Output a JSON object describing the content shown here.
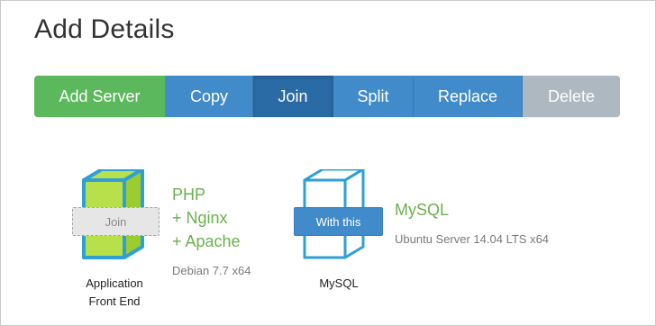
{
  "page": {
    "title": "Add Details"
  },
  "toolbar": {
    "add_server": "Add Server",
    "copy": "Copy",
    "join": "Join",
    "split": "Split",
    "replace": "Replace",
    "delete": "Delete"
  },
  "servers": [
    {
      "chip": "Join",
      "label_line1": "Application",
      "label_line2": "Front End",
      "stack": [
        "PHP",
        "+ Nginx",
        "+ Apache"
      ],
      "os": "Debian 7.7 x64"
    },
    {
      "chip": "With this",
      "label_line1": "MySQL",
      "stack": [
        "MySQL"
      ],
      "os": "Ubuntu Server 14.04 LTS x64"
    }
  ],
  "colors": {
    "green": "#5cb85c",
    "blue": "#428bca",
    "blue_active": "#2a6ba6",
    "gray": "#adb8c0",
    "lime": "#b7e04a",
    "cube_blue": "#2f9fd6",
    "stack_green": "#6ab04c"
  }
}
